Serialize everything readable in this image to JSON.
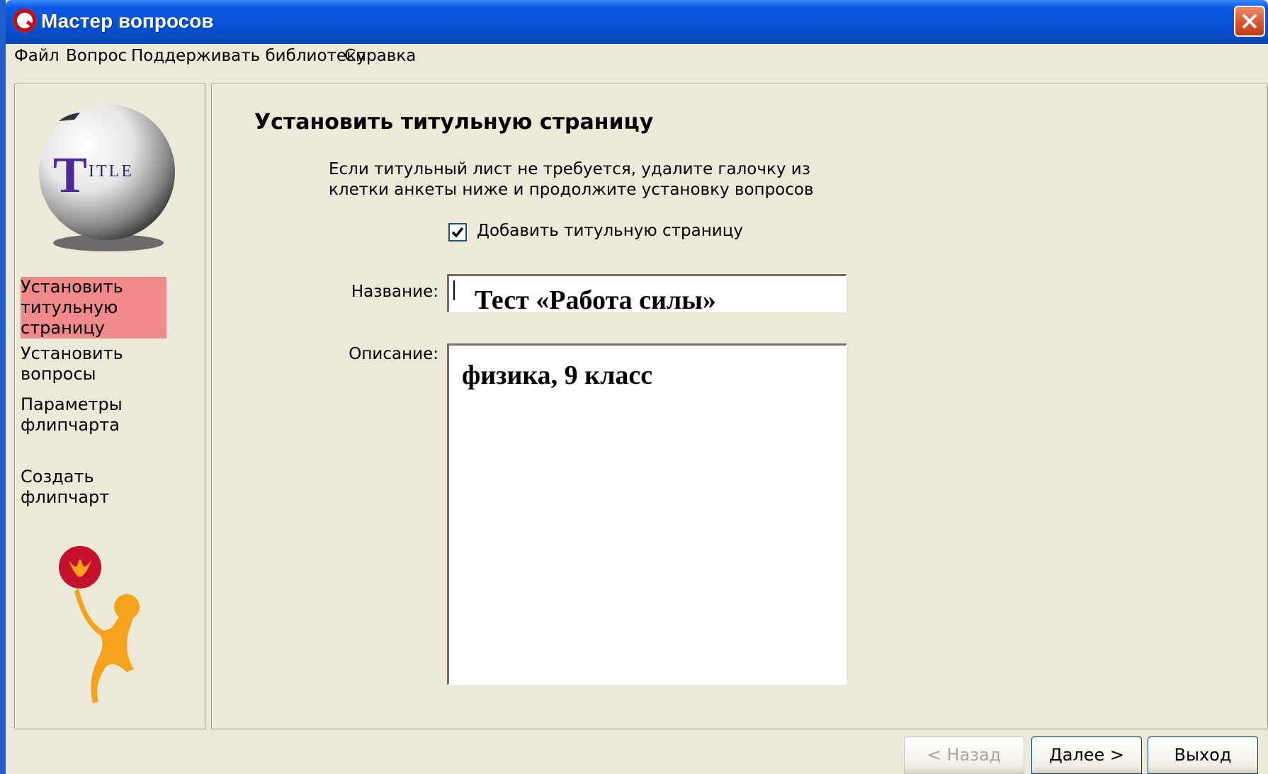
{
  "window": {
    "title": "Мастер вопросов"
  },
  "menu": [
    "Файл",
    "Вопрос",
    "Поддерживать библиотеку",
    "Справка"
  ],
  "sidebar": {
    "logo_text": "TITLE",
    "steps": [
      {
        "label": "Установить титульную страницу",
        "active": true
      },
      {
        "label": "Установить вопросы",
        "active": false
      },
      {
        "label": "Параметры флипчарта",
        "active": false
      },
      {
        "label": "Создать флипчарт",
        "active": false
      }
    ]
  },
  "main": {
    "heading": "Установить титульную страницу",
    "instruction": "Если титульный лист не требуется, удалите галочку из клетки анкеты ниже и продолжите установку вопросов",
    "checkbox": {
      "label": "Добавить титульную страницу",
      "checked": true
    },
    "name": {
      "label": "Название:",
      "value": "Тест «Работа силы»"
    },
    "description": {
      "label": "Описание:",
      "value": "физика, 9 класс"
    }
  },
  "footer": {
    "back": "< Назад",
    "next": "Далее >",
    "exit": "Выход"
  },
  "colors": {
    "active_step": "#f08a8a",
    "titlebar": "#0553d6",
    "window_bg": "#ece9d8",
    "close": "#d8502c"
  },
  "icons": [
    "app-icon",
    "close-icon",
    "title-globe-icon",
    "juggler-icon",
    "checkmark-icon"
  ]
}
